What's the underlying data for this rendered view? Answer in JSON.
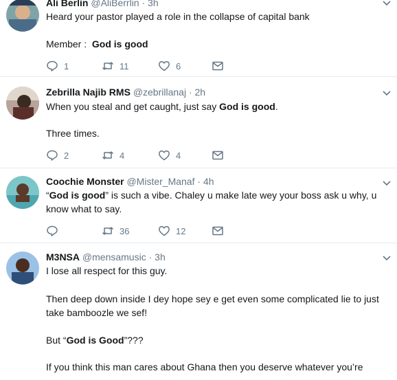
{
  "tweets": [
    {
      "name": "Ali Berlin",
      "handle": "@AliBerrlin",
      "time": "3h",
      "lines": [
        "Heard your pastor played a role in the collapse of capital bank"
      ],
      "member_label": "Member :",
      "member_bold": "God is good",
      "replies": "1",
      "retweets": "11",
      "likes": "6"
    },
    {
      "name": "Zebrilla Najib RMS",
      "handle": "@zebrillanaj",
      "time": "2h",
      "line1_pre": "When you steal and get caught, just say ",
      "line1_bold": "God is good",
      "line1_post": ".",
      "line2": "Three times.",
      "replies": "2",
      "retweets": "4",
      "likes": "4"
    },
    {
      "name": "Coochie Monster",
      "handle": "@Mister_Manaf",
      "time": "4h",
      "line1_pre": "“",
      "line1_bold": "God is good",
      "line1_post": "” is such a vibe. Chaley u make late wey your boss ask u why, u",
      "line2": "know what to say.",
      "replies": "",
      "retweets": "36",
      "likes": "12"
    },
    {
      "name": "M3NSA",
      "handle": "@mensamusic",
      "time": "3h",
      "line1": "I lose all respect for this guy.",
      "line2": "Then deep down inside I dey hope sey e get even some complicated lie to just",
      "line3": "take bamboozle we sef!",
      "line4_pre": "But “",
      "line4_bold": "God is Good",
      "line4_post": "”???",
      "line5": "If you think this man cares about Ghana then you deserve whatever you’re"
    }
  ],
  "separator": "·",
  "colors": {
    "text": "#14171a",
    "muted": "#657786",
    "border": "#e6ecf0"
  },
  "icons": [
    "reply-icon",
    "retweet-icon",
    "like-icon",
    "direct-message-icon",
    "chevron-down-icon"
  ]
}
